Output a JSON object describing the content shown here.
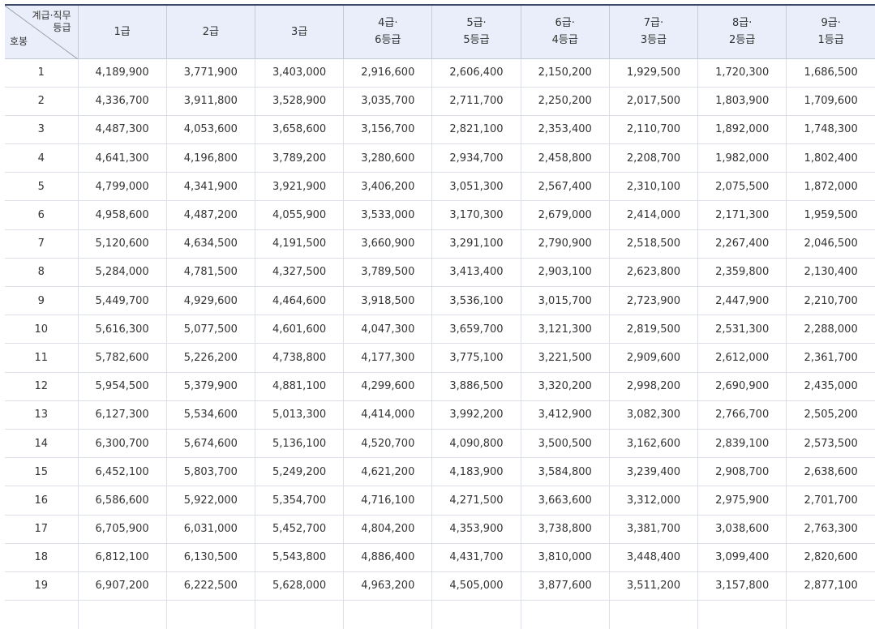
{
  "header": {
    "corner_top_line1": "계급·직무",
    "corner_top_line2": "등급",
    "corner_bottom": "호봉",
    "grades": [
      {
        "line1": "1급",
        "line2": ""
      },
      {
        "line1": "2급",
        "line2": ""
      },
      {
        "line1": "3급",
        "line2": ""
      },
      {
        "line1": "4급·",
        "line2": "6등급"
      },
      {
        "line1": "5급·",
        "line2": "5등급"
      },
      {
        "line1": "6급·",
        "line2": "4등급"
      },
      {
        "line1": "7급·",
        "line2": "3등급"
      },
      {
        "line1": "8급·",
        "line2": "2등급"
      },
      {
        "line1": "9급·",
        "line2": "1등급"
      }
    ]
  },
  "rows": [
    {
      "step": "1",
      "values": [
        "4,189,900",
        "3,771,900",
        "3,403,000",
        "2,916,600",
        "2,606,400",
        "2,150,200",
        "1,929,500",
        "1,720,300",
        "1,686,500"
      ]
    },
    {
      "step": "2",
      "values": [
        "4,336,700",
        "3,911,800",
        "3,528,900",
        "3,035,700",
        "2,711,700",
        "2,250,200",
        "2,017,500",
        "1,803,900",
        "1,709,600"
      ]
    },
    {
      "step": "3",
      "values": [
        "4,487,300",
        "4,053,600",
        "3,658,600",
        "3,156,700",
        "2,821,100",
        "2,353,400",
        "2,110,700",
        "1,892,000",
        "1,748,300"
      ]
    },
    {
      "step": "4",
      "values": [
        "4,641,300",
        "4,196,800",
        "3,789,200",
        "3,280,600",
        "2,934,700",
        "2,458,800",
        "2,208,700",
        "1,982,000",
        "1,802,400"
      ]
    },
    {
      "step": "5",
      "values": [
        "4,799,000",
        "4,341,900",
        "3,921,900",
        "3,406,200",
        "3,051,300",
        "2,567,400",
        "2,310,100",
        "2,075,500",
        "1,872,000"
      ]
    },
    {
      "step": "6",
      "values": [
        "4,958,600",
        "4,487,200",
        "4,055,900",
        "3,533,000",
        "3,170,300",
        "2,679,000",
        "2,414,000",
        "2,171,300",
        "1,959,500"
      ]
    },
    {
      "step": "7",
      "values": [
        "5,120,600",
        "4,634,500",
        "4,191,500",
        "3,660,900",
        "3,291,100",
        "2,790,900",
        "2,518,500",
        "2,267,400",
        "2,046,500"
      ]
    },
    {
      "step": "8",
      "values": [
        "5,284,000",
        "4,781,500",
        "4,327,500",
        "3,789,500",
        "3,413,400",
        "2,903,100",
        "2,623,800",
        "2,359,800",
        "2,130,400"
      ]
    },
    {
      "step": "9",
      "values": [
        "5,449,700",
        "4,929,600",
        "4,464,600",
        "3,918,500",
        "3,536,100",
        "3,015,700",
        "2,723,900",
        "2,447,900",
        "2,210,700"
      ]
    },
    {
      "step": "10",
      "values": [
        "5,616,300",
        "5,077,500",
        "4,601,600",
        "4,047,300",
        "3,659,700",
        "3,121,300",
        "2,819,500",
        "2,531,300",
        "2,288,000"
      ]
    },
    {
      "step": "11",
      "values": [
        "5,782,600",
        "5,226,200",
        "4,738,800",
        "4,177,300",
        "3,775,100",
        "3,221,500",
        "2,909,600",
        "2,612,000",
        "2,361,700"
      ]
    },
    {
      "step": "12",
      "values": [
        "5,954,500",
        "5,379,900",
        "4,881,100",
        "4,299,600",
        "3,886,500",
        "3,320,200",
        "2,998,200",
        "2,690,900",
        "2,435,000"
      ]
    },
    {
      "step": "13",
      "values": [
        "6,127,300",
        "5,534,600",
        "5,013,300",
        "4,414,000",
        "3,992,200",
        "3,412,900",
        "3,082,300",
        "2,766,700",
        "2,505,200"
      ]
    },
    {
      "step": "14",
      "values": [
        "6,300,700",
        "5,674,600",
        "5,136,100",
        "4,520,700",
        "4,090,800",
        "3,500,500",
        "3,162,600",
        "2,839,100",
        "2,573,500"
      ]
    },
    {
      "step": "15",
      "values": [
        "6,452,100",
        "5,803,700",
        "5,249,200",
        "4,621,200",
        "4,183,900",
        "3,584,800",
        "3,239,400",
        "2,908,700",
        "2,638,600"
      ]
    },
    {
      "step": "16",
      "values": [
        "6,586,600",
        "5,922,000",
        "5,354,700",
        "4,716,100",
        "4,271,500",
        "3,663,600",
        "3,312,000",
        "2,975,900",
        "2,701,700"
      ]
    },
    {
      "step": "17",
      "values": [
        "6,705,900",
        "6,031,000",
        "5,452,700",
        "4,804,200",
        "4,353,900",
        "3,738,800",
        "3,381,700",
        "3,038,600",
        "2,763,300"
      ]
    },
    {
      "step": "18",
      "values": [
        "6,812,100",
        "6,130,500",
        "5,543,800",
        "4,886,400",
        "4,431,700",
        "3,810,000",
        "3,448,400",
        "3,099,400",
        "2,820,600"
      ]
    },
    {
      "step": "19",
      "values": [
        "6,907,200",
        "6,222,500",
        "5,628,000",
        "4,963,200",
        "4,505,000",
        "3,877,600",
        "3,511,200",
        "3,157,800",
        "2,877,100"
      ]
    }
  ]
}
